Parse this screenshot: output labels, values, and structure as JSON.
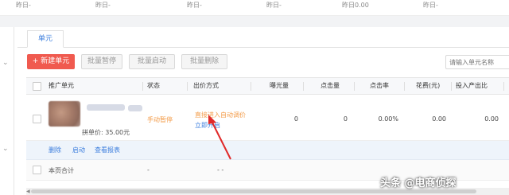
{
  "top_stats": [
    "昨日-",
    "昨日-",
    "昨日-",
    "昨日-",
    "昨日0.00",
    "昨日-"
  ],
  "tab_label": "单元",
  "toolbar": {
    "new_unit": "+ 新建单元",
    "batch_pause": "批量暂停",
    "batch_start": "批量启动",
    "batch_delete": "批量删除",
    "search_placeholder": "请输入单元名称"
  },
  "columns": [
    "推广单元",
    "状态",
    "出价方式",
    "曝光量",
    "点击量",
    "点击率",
    "花费(元)",
    "投入产出比"
  ],
  "row": {
    "unit_price": "拼单价: 35.00元",
    "status": "手动暂停",
    "bid_line1": "直接进入自动调价",
    "bid_line2": "立即开启",
    "impressions": "0",
    "clicks": "0",
    "ctr": "0.00%",
    "cost": "0.00",
    "roi": "0.00"
  },
  "row_actions": [
    "删除",
    "启动",
    "查看报表"
  ],
  "total": {
    "label": "本页合计",
    "status": "-",
    "bid": "- -"
  },
  "watermark": "头条 @电商侦探",
  "colors": {
    "primary": "#f05a4f",
    "link": "#3b7ddd",
    "warning": "#f39c4a",
    "annotation_arrow": "#e02a2a"
  }
}
